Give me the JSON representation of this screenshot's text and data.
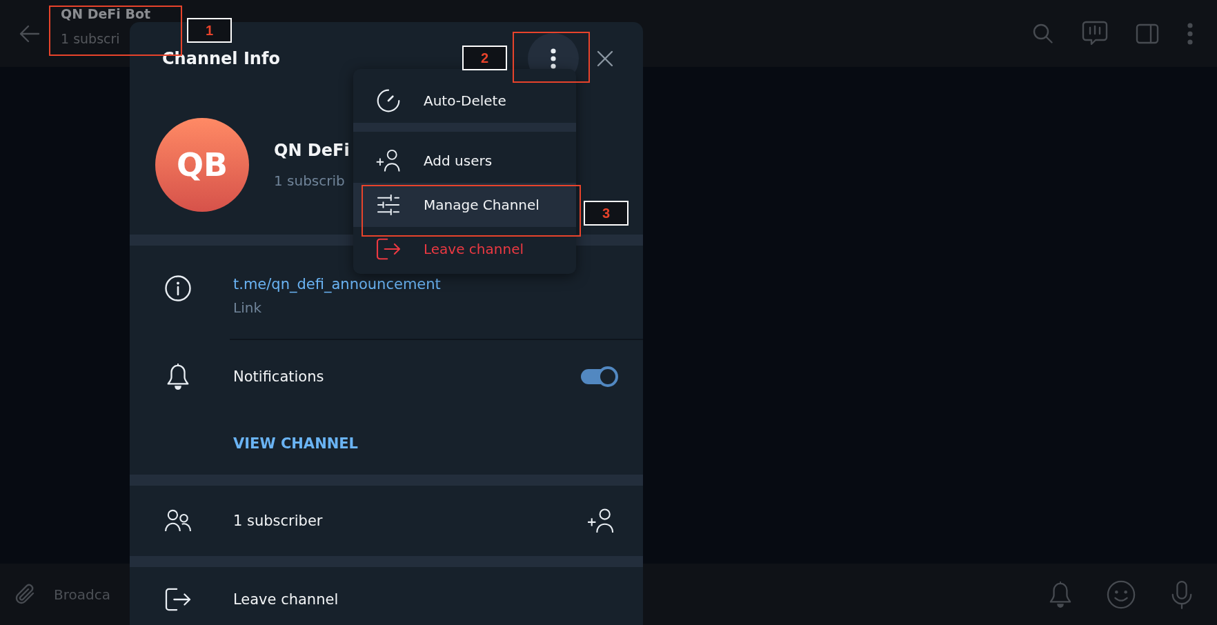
{
  "chat_header": {
    "title": "QN DeFi Bot",
    "subtitle": "1 subscri"
  },
  "composer": {
    "placeholder": "Broadca"
  },
  "channel_info": {
    "title": "Channel Info",
    "avatar_initials": "QB",
    "name": "QN DeFi",
    "subtitle": "1 subscrib",
    "link": {
      "value": "t.me/qn_defi_announcement",
      "caption": "Link"
    },
    "notifications": {
      "label": "Notifications",
      "on": true
    },
    "view_button": "VIEW CHANNEL",
    "subscribers": "1 subscriber",
    "leave": "Leave channel"
  },
  "menu": {
    "items": [
      {
        "label": "Auto-Delete",
        "kind": "timer",
        "danger": false,
        "selected": false,
        "divider_after": true
      },
      {
        "label": "Add users",
        "kind": "add-user",
        "danger": false,
        "selected": false,
        "divider_after": false
      },
      {
        "label": "Manage Channel",
        "kind": "sliders",
        "danger": false,
        "selected": true,
        "divider_after": false
      },
      {
        "label": "Leave channel",
        "kind": "leave",
        "danger": true,
        "selected": false,
        "divider_after": false
      }
    ]
  },
  "annotations": [
    {
      "label": "1"
    },
    {
      "label": "2"
    },
    {
      "label": "3"
    }
  ]
}
